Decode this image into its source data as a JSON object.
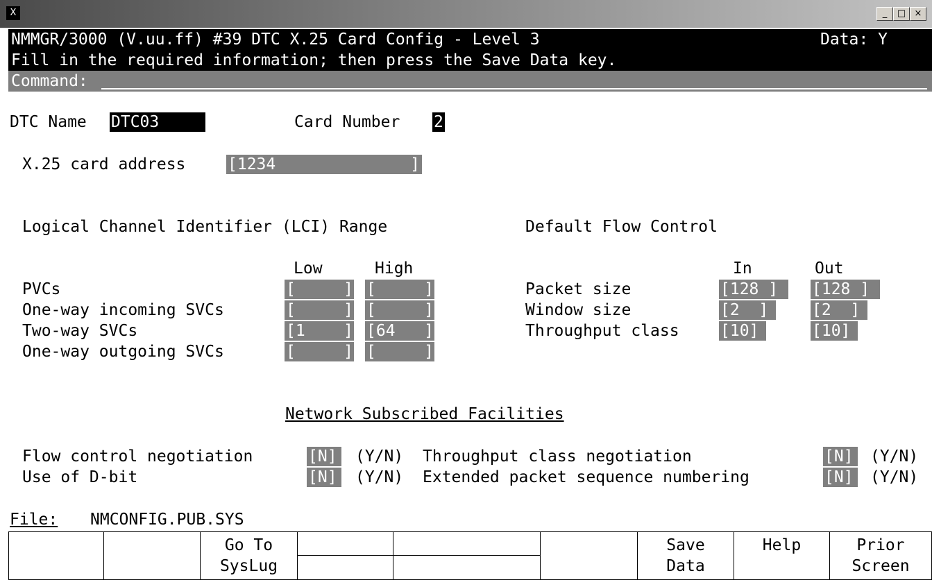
{
  "window": {
    "icon_label": "X",
    "buttons": [
      "_",
      "□",
      "×"
    ]
  },
  "header": {
    "title": "NMMGR/3000 (V.uu.ff) #39 DTC X.25 Card Config - Level 3",
    "data_flag": "Data: Y",
    "instruction": "Fill in the required information; then press the Save Data key.",
    "command_label": "Command:"
  },
  "dtc": {
    "name_label": "DTC Name",
    "name_value": "DTC03",
    "card_label": "Card Number",
    "card_value": "2"
  },
  "address": {
    "label": "X.25 card address",
    "value": "[1234              ]"
  },
  "lci": {
    "heading": "Logical Channel Identifier (LCI) Range",
    "low_header": "Low",
    "high_header": "High",
    "rows": [
      {
        "label": "PVCs",
        "low": "[     ]",
        "high": "[     ]"
      },
      {
        "label": "One-way incoming SVCs",
        "low": "[     ]",
        "high": "[     ]"
      },
      {
        "label": "Two-way SVCs",
        "low": "[1    ]",
        "high": "[64   ]"
      },
      {
        "label": "One-way outgoing SVCs",
        "low": "[     ]",
        "high": "[     ]"
      }
    ]
  },
  "flow": {
    "heading": "Default Flow Control",
    "in_header": "In",
    "out_header": "Out",
    "rows": [
      {
        "label": "Packet size",
        "in": "[128 ]",
        "out": "[128 ]"
      },
      {
        "label": "Window size",
        "in": "[2  ]",
        "out": "[2  ]"
      },
      {
        "label": "Throughput class",
        "in": "[10]",
        "out": "[10]"
      }
    ]
  },
  "facilities": {
    "heading": "Network Subscribed Facilities",
    "yn": "(Y/N)",
    "left": [
      {
        "label": "Flow control negotiation",
        "value": "[N]"
      },
      {
        "label": "Use of D-bit",
        "value": "[N]"
      }
    ],
    "right": [
      {
        "label": "Throughput class negotiation",
        "value": "[N]"
      },
      {
        "label": "Extended packet sequence numbering",
        "value": "[N]"
      }
    ]
  },
  "file": {
    "label": "File:",
    "value": "NMCONFIG.PUB.SYS"
  },
  "fkeys": [
    {
      "line1": "",
      "line2": ""
    },
    {
      "line1": "",
      "line2": ""
    },
    {
      "line1": "Go To",
      "line2": "SysLug"
    },
    {
      "line1": "",
      "line2": ""
    },
    {
      "line1": "",
      "line2": ""
    },
    {
      "line1": "Save",
      "line2": "Data"
    },
    {
      "line1": "Help",
      "line2": ""
    },
    {
      "line1": "Prior",
      "line2": "Screen"
    }
  ]
}
